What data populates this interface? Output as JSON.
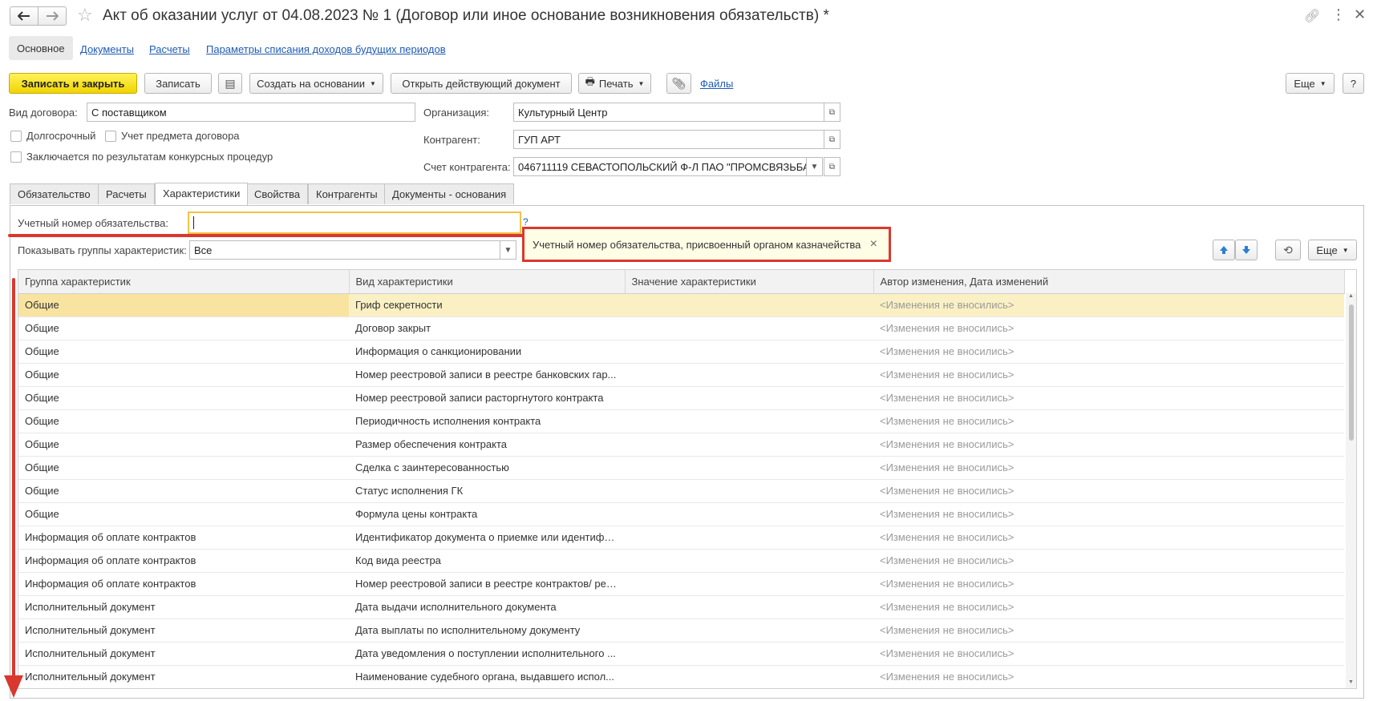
{
  "window": {
    "title": "Акт об оказании услуг от 04.08.2023 № 1 (Договор или иное основание возникновения обязательств) *"
  },
  "nav_tabs": [
    {
      "label": "Основное"
    },
    {
      "label": "Документы"
    },
    {
      "label": "Расчеты"
    },
    {
      "label": "Параметры списания доходов будущих периодов"
    }
  ],
  "toolbar": {
    "save_close": "Записать и закрыть",
    "save": "Записать",
    "create_based": "Создать на основании",
    "open_doc": "Открыть действующий документ",
    "print": "Печать",
    "files": "Файлы",
    "more": "Еще",
    "help": "?"
  },
  "form": {
    "contract_type_label": "Вид договора:",
    "contract_type_value": "С поставщиком",
    "long_term": "Долгосрочный",
    "subject_accounting": "Учет предмета договора",
    "competitive": "Заключается по результатам конкурсных процедур",
    "org_label": "Организация:",
    "org_value": "Культурный Центр",
    "counterparty_label": "Контрагент:",
    "counterparty_value": "ГУП АРТ",
    "account_label": "Счет контрагента:",
    "account_value": "046711119 СЕВАСТОПОЛЬСКИЙ Ф-Л ПАО \"ПРОМСВЯЗЬБАНК\""
  },
  "tabs": [
    {
      "label": "Обязательство"
    },
    {
      "label": "Расчеты"
    },
    {
      "label": "Характеристики"
    },
    {
      "label": "Свойства"
    },
    {
      "label": "Контрагенты"
    },
    {
      "label": "Документы - основания"
    }
  ],
  "char_tab": {
    "reg_number_label": "Учетный номер обязательства:",
    "reg_number_value": "",
    "help_mark": "?",
    "tooltip": "Учетный номер обязательства, присвоенный органом казначейства",
    "tooltip_close": "×",
    "show_groups_label": "Показывать группы характеристик:",
    "show_groups_value": "Все",
    "more": "Еще"
  },
  "table": {
    "columns": [
      "Группа характеристик",
      "Вид характеристики",
      "Значение характеристики",
      "Автор изменения, Дата изменений"
    ],
    "rows": [
      [
        "Общие",
        "Гриф секретности",
        "",
        "<Изменения не вносились>"
      ],
      [
        "Общие",
        "Договор закрыт",
        "",
        "<Изменения не вносились>"
      ],
      [
        "Общие",
        "Информация о санкционировании",
        "",
        "<Изменения не вносились>"
      ],
      [
        "Общие",
        "Номер реестровой записи в реестре банковских гар...",
        "",
        "<Изменения не вносились>"
      ],
      [
        "Общие",
        "Номер реестровой записи расторгнутого контракта",
        "",
        "<Изменения не вносились>"
      ],
      [
        "Общие",
        "Периодичность исполнения контракта",
        "",
        "<Изменения не вносились>"
      ],
      [
        "Общие",
        "Размер обеспечения контракта",
        "",
        "<Изменения не вносились>"
      ],
      [
        "Общие",
        "Сделка с заинтересованностью",
        "",
        "<Изменения не вносились>"
      ],
      [
        "Общие",
        "Статус исполнения ГК",
        "",
        "<Изменения не вносились>"
      ],
      [
        "Общие",
        "Формула цены контракта",
        "",
        "<Изменения не вносились>"
      ],
      [
        "Информация об оплате контрактов",
        "Идентификатор документа о приемке или идентифик...",
        "",
        "<Изменения не вносились>"
      ],
      [
        "Информация об оплате контрактов",
        "Код вида реестра",
        "",
        "<Изменения не вносились>"
      ],
      [
        "Информация об оплате контрактов",
        "Номер реестровой записи в реестре контрактов/ рее...",
        "",
        "<Изменения не вносились>"
      ],
      [
        "Исполнительный документ",
        "Дата выдачи исполнительного документа",
        "",
        "<Изменения не вносились>"
      ],
      [
        "Исполнительный документ",
        "Дата выплаты по исполнительному документу",
        "",
        "<Изменения не вносились>"
      ],
      [
        "Исполнительный документ",
        "Дата уведомления о поступлении исполнительного ...",
        "",
        "<Изменения не вносились>"
      ],
      [
        "Исполнительный документ",
        "Наименование судебного органа, выдавшего испол...",
        "",
        "<Изменения не вносились>"
      ]
    ]
  },
  "colors": {
    "accent_yellow": "#f0d400",
    "link_blue": "#1e5bb3",
    "annotation_red": "#d9382f",
    "selected_row": "#fbf0c4",
    "tooltip_bg": "#fefde6"
  }
}
